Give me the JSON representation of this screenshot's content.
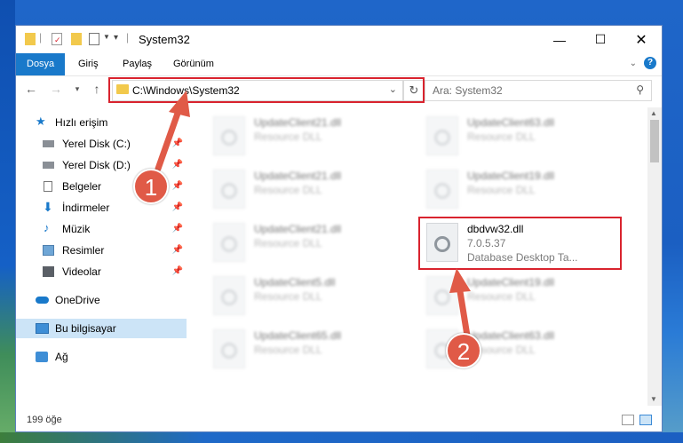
{
  "window": {
    "title": "System32"
  },
  "ribbon": {
    "tabs": [
      "Dosya",
      "Giriş",
      "Paylaş",
      "Görünüm"
    ],
    "help_label": "?"
  },
  "address": {
    "path": "C:\\Windows\\System32"
  },
  "search": {
    "placeholder": "Ara: System32"
  },
  "sidebar": {
    "items": [
      {
        "label": "Hızlı erişim",
        "icon": "star-icon",
        "pinned": false
      },
      {
        "label": "Yerel Disk (C:)",
        "icon": "disk-icon",
        "pinned": true
      },
      {
        "label": "Yerel Disk (D:)",
        "icon": "disk-icon",
        "pinned": true
      },
      {
        "label": "Belgeler",
        "icon": "documents-icon",
        "pinned": true
      },
      {
        "label": "İndirmeler",
        "icon": "download-icon",
        "pinned": true
      },
      {
        "label": "Müzik",
        "icon": "music-icon",
        "pinned": true
      },
      {
        "label": "Resimler",
        "icon": "pictures-icon",
        "pinned": true
      },
      {
        "label": "Videolar",
        "icon": "videos-icon",
        "pinned": true
      },
      {
        "label": "OneDrive",
        "icon": "cloud-icon",
        "pinned": false
      },
      {
        "label": "Bu bilgisayar",
        "icon": "computer-icon",
        "pinned": false,
        "selected": true
      },
      {
        "label": "Ağ",
        "icon": "network-icon",
        "pinned": false
      }
    ]
  },
  "files": [
    {
      "name": "UpdateClient21.dll",
      "type": "Resource DLL"
    },
    {
      "name": "UpdateClient63.dll",
      "type": "Resource DLL"
    },
    {
      "name": "UpdateClient21.dll",
      "type": "Resource DLL"
    },
    {
      "name": "UpdateClient19.dll",
      "type": "Resource DLL"
    },
    {
      "name": "UpdateClient21.dll",
      "type": "Resource DLL"
    },
    {
      "name": "dbdvw32.dll",
      "version": "7.0.5.37",
      "type": "Database Desktop Ta..."
    },
    {
      "name": "UpdateClient5.dll",
      "type": "Resource DLL"
    },
    {
      "name": "UpdateClient19.dll",
      "type": "Resource DLL"
    },
    {
      "name": "UpdateClient65.dll",
      "type": "Resource DLL"
    },
    {
      "name": "UpdateClient63.dll",
      "type": "Resource DLL"
    }
  ],
  "status": {
    "item_count": "199 öğe"
  },
  "annotations": {
    "step1": "1",
    "step2": "2"
  },
  "colors": {
    "accent": "#1979ca",
    "highlight": "#d9232e",
    "badge": "#e05a47",
    "selected": "#cce4f7"
  }
}
